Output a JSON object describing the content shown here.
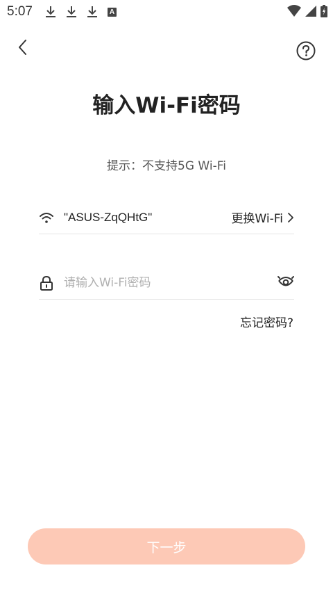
{
  "status_bar": {
    "time": "5:07",
    "notification_letter": "A"
  },
  "header": {
    "title": "输入Wi-Fi密码",
    "hint": "提示：不支持5G Wi-Fi"
  },
  "wifi": {
    "ssid": "\"ASUS-ZqQHtG\"",
    "change_label": "更换Wi-Fi"
  },
  "password": {
    "value": "",
    "placeholder": "请输入Wi-Fi密码"
  },
  "forgot_label": "忘记密码?",
  "next_button_label": "下一步",
  "colors": {
    "accent_button": "#fdc9b6",
    "text": "#222222",
    "divider": "#e4e4e4"
  }
}
